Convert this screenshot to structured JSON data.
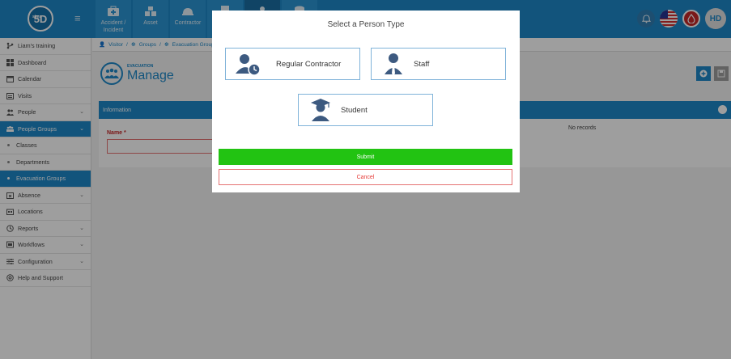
{
  "app": {
    "logo_text": "5D",
    "logo_small": "sims"
  },
  "topnav": {
    "items": [
      {
        "label": "Accident / Incident",
        "icon": "medical-kit-icon"
      },
      {
        "label": "Asset",
        "icon": "asset-boxes-icon"
      },
      {
        "label": "Contractor",
        "icon": "hard-hat-icon"
      },
      {
        "label": "",
        "icon": "document-icon"
      },
      {
        "label": "",
        "icon": "person-icon"
      },
      {
        "label": "",
        "icon": "database-icon"
      }
    ]
  },
  "user": {
    "initials": "HD"
  },
  "sidebar": {
    "items": [
      {
        "label": "Liam's training",
        "icon": "branch-icon"
      },
      {
        "label": "Dashboard",
        "icon": "dashboard-icon"
      },
      {
        "label": "Calendar",
        "icon": "calendar-icon"
      },
      {
        "label": "Visits",
        "icon": "visits-icon"
      },
      {
        "label": "People",
        "icon": "people-icon"
      },
      {
        "label": "People Groups",
        "icon": "people-groups-icon"
      },
      {
        "label": "Classes"
      },
      {
        "label": "Departments"
      },
      {
        "label": "Evacuation Groups"
      },
      {
        "label": "Absence",
        "icon": "absence-icon"
      },
      {
        "label": "Locations",
        "icon": "locations-icon"
      },
      {
        "label": "Reports",
        "icon": "reports-icon"
      },
      {
        "label": "Workflows",
        "icon": "workflows-icon"
      },
      {
        "label": "Configuration",
        "icon": "configuration-icon"
      },
      {
        "label": "Help and Support",
        "icon": "help-icon"
      }
    ]
  },
  "breadcrumb": {
    "items": [
      "Visitor",
      "/",
      "Groups",
      "/",
      "Evacuation Groups"
    ]
  },
  "page": {
    "sup_title": "EVACUATION",
    "title": "Manage"
  },
  "panel": {
    "title": "Information",
    "name_label": "Name",
    "required_marker": "*",
    "no_records": "No records"
  },
  "modal": {
    "title": "Select a Person Type",
    "options": [
      {
        "label": "Regular Contractor",
        "icon": "contractor-clock-icon"
      },
      {
        "label": "Staff",
        "icon": "staff-icon"
      },
      {
        "label": "Student",
        "icon": "student-graduate-icon"
      }
    ],
    "submit_label": "Submit",
    "cancel_label": "Cancel"
  },
  "colors": {
    "primary": "#1e88c8",
    "submit": "#22c312",
    "cancel_border": "#e57373",
    "required": "#c62828"
  }
}
